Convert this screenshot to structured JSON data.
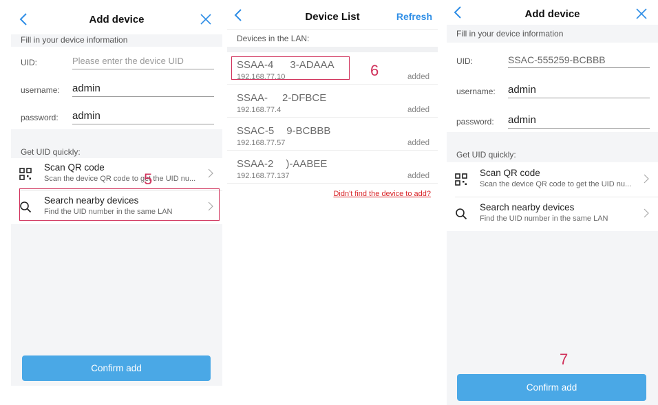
{
  "screens": [
    {
      "title": "Add device",
      "section_info": "Fill in your device information",
      "fields": [
        {
          "label": "UID:",
          "value": "",
          "placeholder": "Please enter the device UID"
        },
        {
          "label": "username:",
          "value": "admin"
        },
        {
          "label": "password:",
          "value": "admin"
        }
      ],
      "section_quick": "Get UID quickly:",
      "options": [
        {
          "title": "Scan QR code",
          "subtitle": "Scan the device QR code to get the UID nu...",
          "icon": "qr-code-icon"
        },
        {
          "title": "Search nearby devices",
          "subtitle": "Find the UID number in the same LAN",
          "icon": "search-icon"
        }
      ],
      "confirm_label": "Confirm add",
      "step": "5"
    },
    {
      "title": "Device List",
      "refresh_label": "Refresh",
      "section": "Devices in the LAN:",
      "devices": [
        {
          "name": "SSAA-4        3-ADAAA",
          "ip": "192.168.77.10",
          "status": "added"
        },
        {
          "name": "SSAA-       2-DFBCE",
          "ip": "192.168.77.4",
          "status": "added"
        },
        {
          "name": "SSAC-5      9-BCBBB",
          "ip": "192.168.77.57",
          "status": "added"
        },
        {
          "name": "SSAA-2      )-AABEE",
          "ip": "192.168.77.137",
          "status": "added"
        }
      ],
      "not_found_link": "Didn't find the device to add?",
      "step": "6"
    },
    {
      "title": "Add device",
      "section_info": "Fill in your device information",
      "fields": [
        {
          "label": "UID:",
          "value": "SSAC-555259-BCBBB"
        },
        {
          "label": "username:",
          "value": "admin"
        },
        {
          "label": "password:",
          "value": "admin"
        }
      ],
      "section_quick": "Get UID quickly:",
      "options": [
        {
          "title": "Scan QR code",
          "subtitle": "Scan the device QR code to get the UID nu...",
          "icon": "qr-code-icon"
        },
        {
          "title": "Search nearby devices",
          "subtitle": "Find the UID number in the same LAN",
          "icon": "search-icon"
        }
      ],
      "confirm_label": "Confirm add",
      "step": "7"
    }
  ],
  "colors": {
    "accent": "#4aa8e6",
    "highlight": "#d0305a",
    "link": "#d9262a",
    "refresh": "#2f8ee6"
  }
}
